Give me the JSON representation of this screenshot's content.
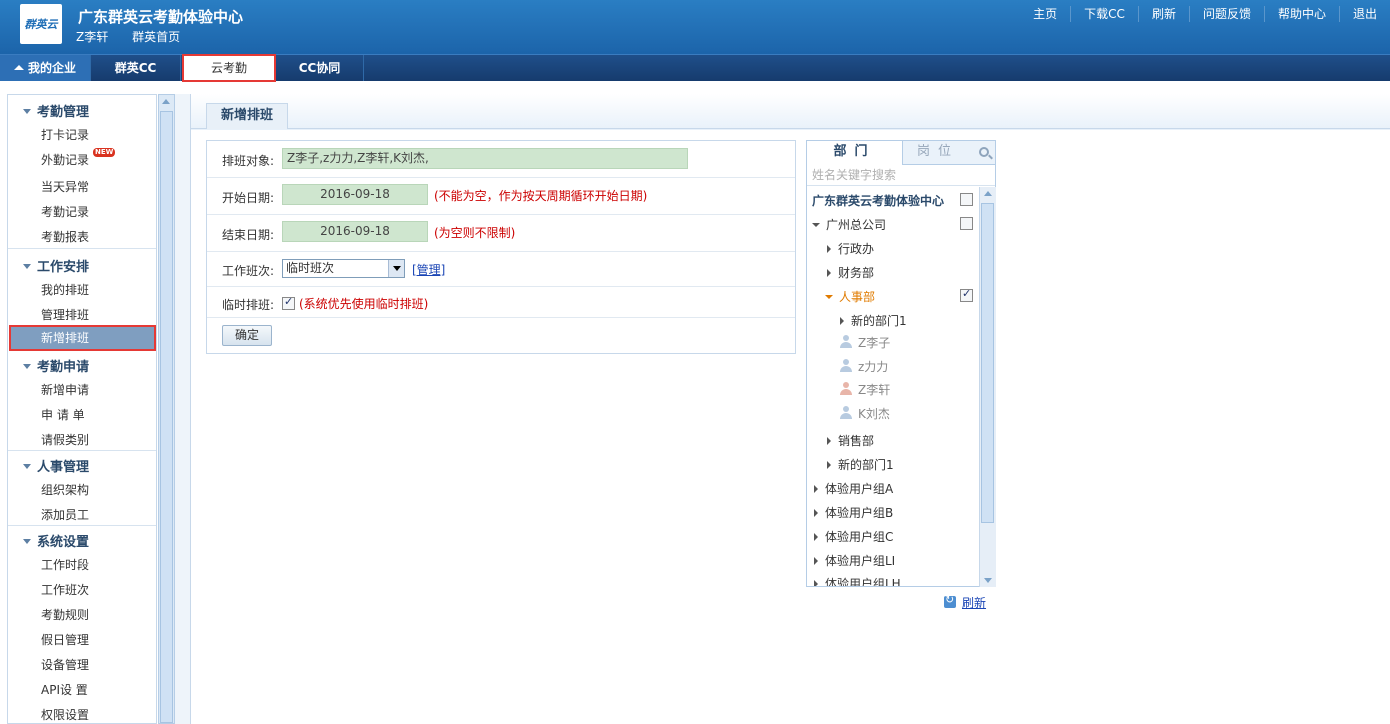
{
  "header": {
    "org_name": "广东群英云考勤体验中心",
    "logo_text": "群英云",
    "user_name": "Z李轩",
    "home_link": "群英首页",
    "links": [
      "主页",
      "下载CC",
      "刷新",
      "问题反馈",
      "帮助中心",
      "退出"
    ]
  },
  "nav": {
    "home": "我的企业",
    "cc": "群英CC",
    "yun": "云考勤",
    "xt": "CC协同"
  },
  "sidebar": {
    "groups": [
      {
        "title": "考勤管理",
        "items": [
          "打卡记录",
          "外勤记录",
          "当天异常",
          "考勤记录",
          "考勤报表"
        ]
      },
      {
        "title": "工作安排",
        "items": [
          "我的排班",
          "管理排班",
          "新增排班"
        ]
      },
      {
        "title": "考勤申请",
        "items": [
          "新增申请",
          "申 请 单",
          "请假类别"
        ]
      },
      {
        "title": "人事管理",
        "items": [
          "组织架构",
          "添加员工"
        ]
      },
      {
        "title": "系统设置",
        "items": [
          "工作时段",
          "工作班次",
          "考勤规则",
          "假日管理",
          "设备管理",
          "API设 置",
          "权限设置"
        ]
      }
    ],
    "new_badge": "NEW"
  },
  "main": {
    "tab_title": "新增排班",
    "form": {
      "target_label": "排班对象:",
      "target_value": "Z李子,z力力,Z李轩,K刘杰,",
      "start_label": "开始日期:",
      "start_value": "2016-09-18",
      "start_hint": "(不能为空，作为按天周期循环开始日期)",
      "end_label": "结束日期:",
      "end_value": "2016-09-18",
      "end_hint": "(为空则不限制)",
      "shift_label": "工作班次:",
      "shift_value": "临时班次",
      "manage_link": "[管理]",
      "temp_label": "临时排班:",
      "temp_hint": "(系统优先使用临时排班)",
      "submit": "确定"
    }
  },
  "tree": {
    "tab_dept": "部门",
    "tab_pos": "岗位",
    "search_placeholder": "姓名关键字搜索",
    "root": "广东群英云考勤体验中心",
    "nodes": {
      "gz": "广州总公司",
      "xzb": "行政办",
      "cwb": "财务部",
      "rsb": "人事部",
      "xbm1": "新的部门1",
      "p1": "Z李子",
      "p2": "z力力",
      "p3": "Z李轩",
      "p4": "K刘杰",
      "xsb": "销售部",
      "xbm2": "新的部门1",
      "ga": "体验用户组A",
      "gb": "体验用户组B",
      "gc": "体验用户组C",
      "gli": "体验用户组LI",
      "glh": "体验用户组LH"
    },
    "refresh": "刷新"
  }
}
